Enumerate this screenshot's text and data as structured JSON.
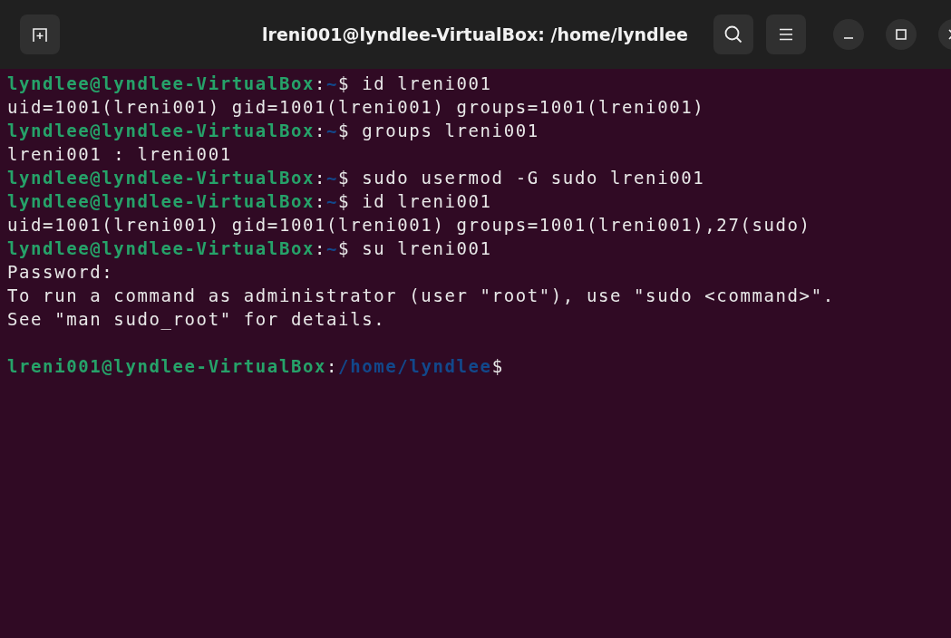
{
  "window": {
    "title": "lreni001@lyndlee-VirtualBox: /home/lyndlee"
  },
  "lines": [
    {
      "kind": "prompt",
      "user_host": "lyndlee@lyndlee-VirtualBox",
      "separator": ":",
      "path": "~",
      "prompt_char": "$",
      "command": "id lreni001"
    },
    {
      "kind": "output",
      "text": "uid=1001(lreni001) gid=1001(lreni001) groups=1001(lreni001)"
    },
    {
      "kind": "prompt",
      "user_host": "lyndlee@lyndlee-VirtualBox",
      "separator": ":",
      "path": "~",
      "prompt_char": "$",
      "command": "groups lreni001"
    },
    {
      "kind": "output",
      "text": "lreni001 : lreni001"
    },
    {
      "kind": "prompt",
      "user_host": "lyndlee@lyndlee-VirtualBox",
      "separator": ":",
      "path": "~",
      "prompt_char": "$",
      "command": "sudo usermod -G sudo lreni001"
    },
    {
      "kind": "prompt",
      "user_host": "lyndlee@lyndlee-VirtualBox",
      "separator": ":",
      "path": "~",
      "prompt_char": "$",
      "command": "id lreni001"
    },
    {
      "kind": "output",
      "text": "uid=1001(lreni001) gid=1001(lreni001) groups=1001(lreni001),27(sudo)"
    },
    {
      "kind": "prompt",
      "user_host": "lyndlee@lyndlee-VirtualBox",
      "separator": ":",
      "path": "~",
      "prompt_char": "$",
      "command": "su lreni001"
    },
    {
      "kind": "output",
      "text": "Password:"
    },
    {
      "kind": "output",
      "text": "To run a command as administrator (user \"root\"), use \"sudo <command>\"."
    },
    {
      "kind": "output",
      "text": "See \"man sudo_root\" for details."
    },
    {
      "kind": "blank"
    },
    {
      "kind": "prompt",
      "user_host": "lreni001@lyndlee-VirtualBox",
      "separator": ":",
      "path": "/home/lyndlee",
      "prompt_char": "$"
    }
  ]
}
